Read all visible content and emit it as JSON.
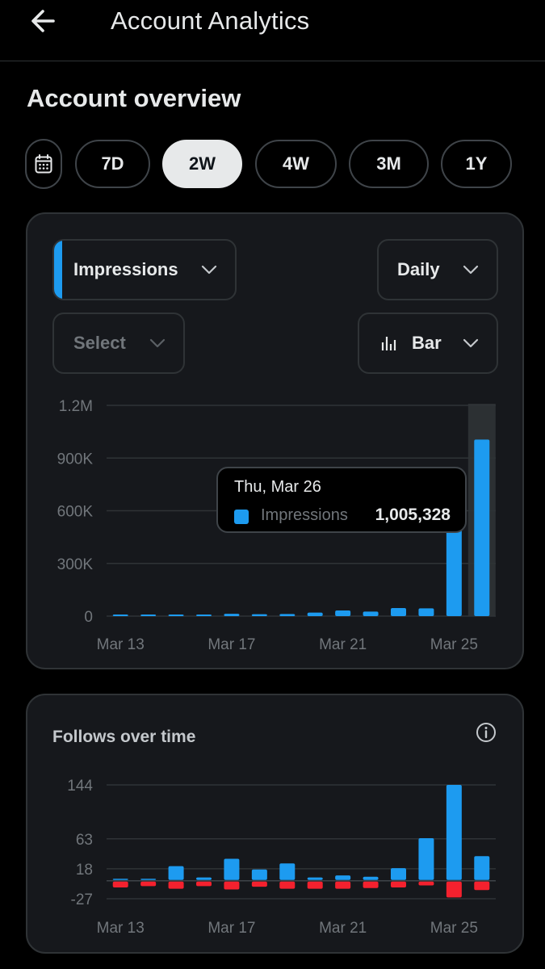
{
  "header": {
    "title": "Account Analytics",
    "back_icon": "arrow-left-icon"
  },
  "overview": {
    "title": "Account overview",
    "calendar_icon": "calendar-icon",
    "ranges": [
      {
        "label": "7D",
        "active": false
      },
      {
        "label": "2W",
        "active": true
      },
      {
        "label": "4W",
        "active": false
      },
      {
        "label": "3M",
        "active": false
      },
      {
        "label": "1Y",
        "active": false
      }
    ]
  },
  "impressions_card": {
    "metric_select": "Impressions",
    "interval_select": "Daily",
    "compare_select_placeholder": "Select",
    "chart_type_select": "Bar",
    "accent_color": "#1d9bf0",
    "tooltip": {
      "date": "Thu, Mar 26",
      "series": "Impressions",
      "value": "1,005,328"
    }
  },
  "follows_card": {
    "title": "Follows over time",
    "info_icon": "info-icon"
  },
  "chart_data": [
    {
      "type": "bar",
      "title": "",
      "xlabel": "",
      "ylabel": "",
      "x_tick_labels": [
        "Mar 13",
        "Mar 17",
        "Mar 21",
        "Mar 25"
      ],
      "y_tick_labels": [
        "0",
        "300K",
        "600K",
        "900K",
        "1.2M"
      ],
      "ylim": [
        0,
        1200000
      ],
      "grid": true,
      "categories": [
        "Mar 13",
        "Mar 14",
        "Mar 15",
        "Mar 16",
        "Mar 17",
        "Mar 18",
        "Mar 19",
        "Mar 20",
        "Mar 21",
        "Mar 22",
        "Mar 23",
        "Mar 24",
        "Mar 25",
        "Mar 26"
      ],
      "series": [
        {
          "name": "Impressions",
          "color": "#1d9bf0",
          "values": [
            6000,
            5000,
            5000,
            6000,
            13000,
            11000,
            12000,
            20000,
            32000,
            26000,
            46000,
            44000,
            510000,
            1005328
          ]
        }
      ],
      "highlighted_category": "Mar 26"
    },
    {
      "type": "bar",
      "title": "Follows over time",
      "xlabel": "",
      "ylabel": "",
      "x_tick_labels": [
        "Mar 13",
        "Mar 17",
        "Mar 21",
        "Mar 25"
      ],
      "y_tick_labels": [
        "-27",
        "18",
        "63",
        "144"
      ],
      "ylim": [
        -27,
        144
      ],
      "grid": true,
      "categories": [
        "Mar 13",
        "Mar 14",
        "Mar 15",
        "Mar 16",
        "Mar 17",
        "Mar 18",
        "Mar 19",
        "Mar 20",
        "Mar 21",
        "Mar 22",
        "Mar 23",
        "Mar 24",
        "Mar 25",
        "Mar 26"
      ],
      "series": [
        {
          "color": "#1d9bf0",
          "values": [
            3,
            3,
            22,
            5,
            33,
            17,
            26,
            5,
            8,
            6,
            19,
            64,
            144,
            37
          ]
        },
        {
          "color": "#f4212e",
          "values": [
            -10,
            -8,
            -12,
            -8,
            -13,
            -9,
            -12,
            -12,
            -12,
            -11,
            -10,
            -7,
            -25,
            -14
          ]
        }
      ]
    }
  ]
}
